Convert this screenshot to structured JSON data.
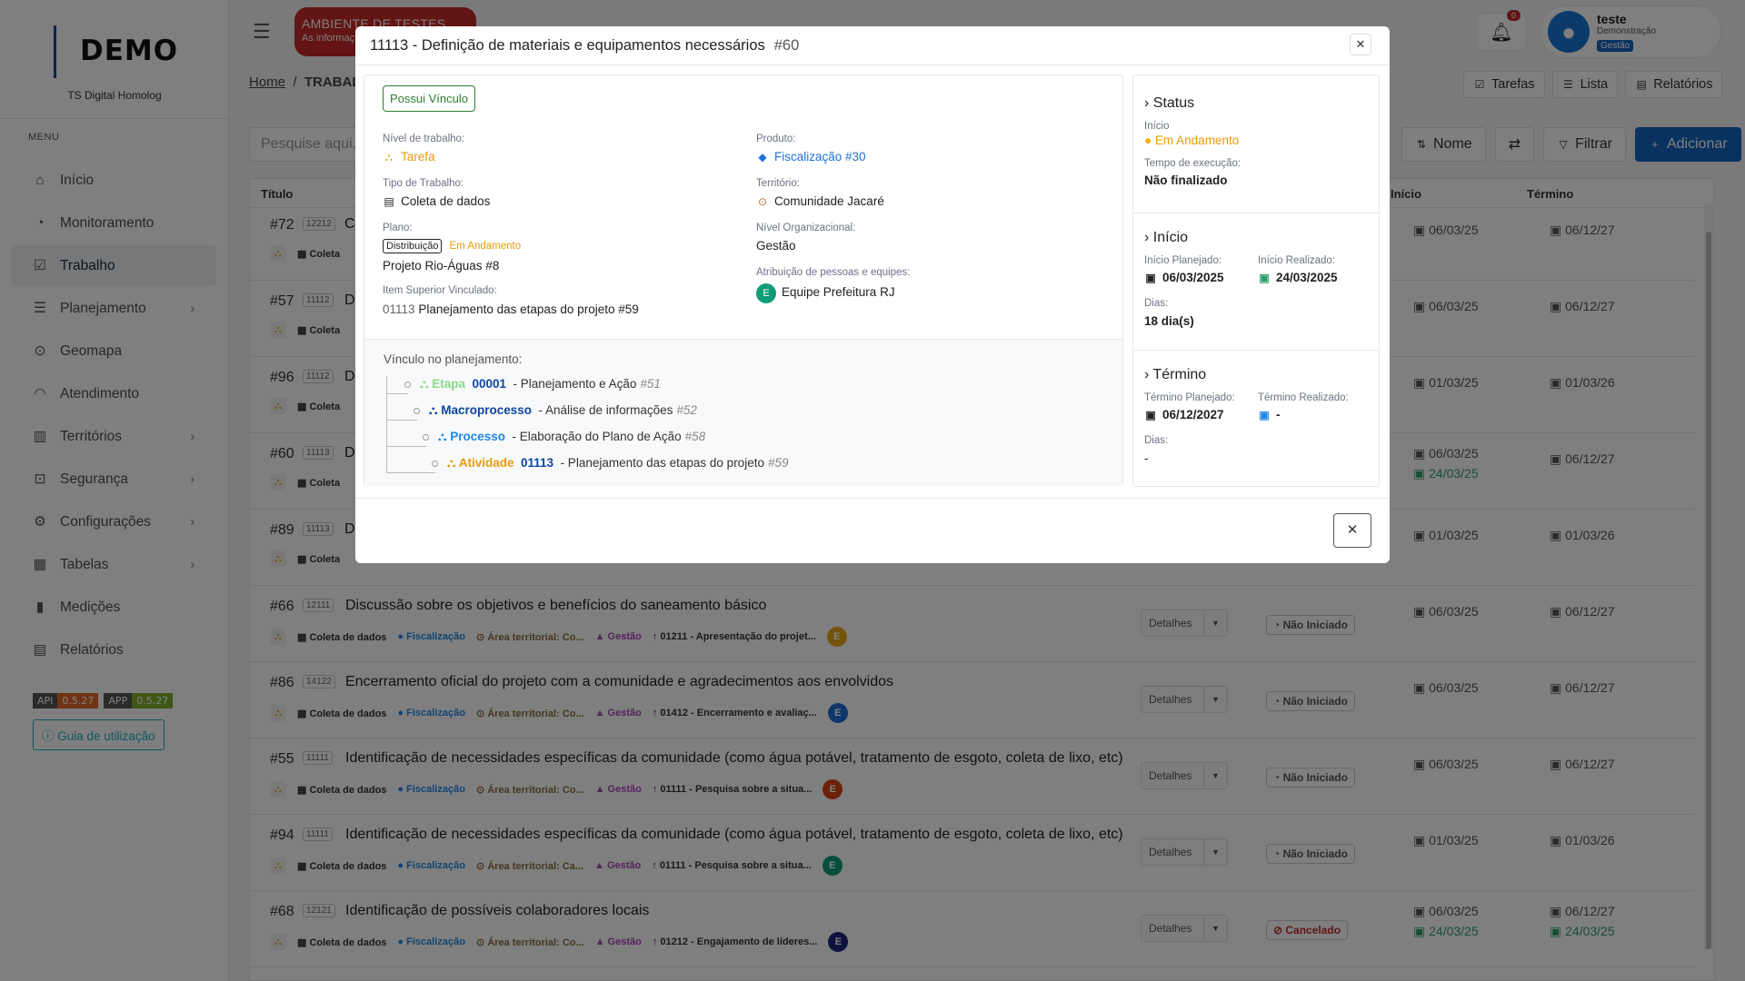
{
  "sidebar": {
    "logo": "DEMO",
    "subtitle": "TS Digital Homolog",
    "menu_title": "MENU",
    "items": [
      {
        "label": "Início",
        "icon": "home-icon"
      },
      {
        "label": "Monitoramento",
        "icon": "gauge-icon"
      },
      {
        "label": "Trabalho",
        "icon": "checkbox-icon"
      },
      {
        "label": "Planejamento",
        "icon": "list-icon"
      },
      {
        "label": "Geomapa",
        "icon": "map-pin-icon"
      },
      {
        "label": "Atendimento",
        "icon": "headset-icon"
      },
      {
        "label": "Territórios",
        "icon": "map-icon"
      },
      {
        "label": "Segurança",
        "icon": "lock-icon"
      },
      {
        "label": "Configurações",
        "icon": "gear-icon"
      },
      {
        "label": "Tabelas",
        "icon": "table-icon"
      },
      {
        "label": "Medições",
        "icon": "bar-chart-icon"
      },
      {
        "label": "Relatórios",
        "icon": "report-icon"
      }
    ],
    "api_label": "API",
    "api_version": "0.5.27",
    "app_label": "APP",
    "app_version": "0.5.27",
    "guide": "Guia de utilização"
  },
  "header": {
    "env_title": "AMBIENTE DE TESTES",
    "env_sub": "As informaç",
    "notif_count": "0",
    "user_name": "teste",
    "user_org": "Demonstração",
    "user_badge": "Gestão"
  },
  "breadcrumb": {
    "home": "Home",
    "current": "TRABALI"
  },
  "views": {
    "tasks": "Tarefas",
    "list": "Lista",
    "reports": "Relatórios"
  },
  "toolbar": {
    "search_placeholder": "Pesquise aqui...",
    "sort": "Nome",
    "filter": "Filtrar",
    "add": "Adicionar"
  },
  "table": {
    "col_title": "Título",
    "col_start": "Início",
    "col_end": "Término",
    "details_label": "Detalhes",
    "rows": [
      {
        "num": "#72",
        "code": "12212",
        "title": "C",
        "type": "Coleta",
        "d1": "06/03/25",
        "d1b": "",
        "d2": "06/12/27"
      },
      {
        "num": "#57",
        "code": "11112",
        "title": "D",
        "type": "Coleta",
        "d1": "06/03/25",
        "d1b": "",
        "d2": "06/12/27"
      },
      {
        "num": "#96",
        "code": "11112",
        "title": "D",
        "type": "Coleta",
        "d1": "01/03/25",
        "d1b": "",
        "d2": "01/03/26"
      },
      {
        "num": "#60",
        "code": "11113",
        "title": "D",
        "type": "Coleta",
        "d1": "06/03/25",
        "d1b": "24/03/25",
        "d2": "06/12/27"
      },
      {
        "num": "#89",
        "code": "11113",
        "title": "D",
        "type": "Coleta",
        "d1": "01/03/25",
        "d1b": "",
        "d2": "01/03/26"
      },
      {
        "num": "#66",
        "code": "12111",
        "title": "Discussão sobre os objetivos e benefícios do saneamento básico",
        "type": "Coleta de dados",
        "prod": "Fiscalização",
        "terr": "Área territorial: Co...",
        "org": "Gestão",
        "parent": "01211 - Apresentação do projet...",
        "avatar": "E",
        "avatar_color": "#e6a817",
        "status": "Não Iniciado",
        "d1": "06/03/25",
        "d1b": "",
        "d2": "06/12/27"
      },
      {
        "num": "#86",
        "code": "14122",
        "title": "Encerramento oficial do projeto com a comunidade e agradecimentos aos envolvidos",
        "type": "Coleta de dados",
        "prod": "Fiscalização",
        "terr": "Área territorial: Co...",
        "org": "Gestão",
        "parent": "01412 - Encerramento e avaliaç...",
        "avatar": "E",
        "avatar_color": "#1e6fd9",
        "status": "Não Iniciado",
        "d1": "06/03/25",
        "d1b": "",
        "d2": "06/12/27"
      },
      {
        "num": "#55",
        "code": "11111",
        "title": "Identificação de necessidades específicas da comunidade (como água potável, tratamento de esgoto, coleta de lixo, etc)",
        "type": "Coleta de dados",
        "prod": "Fiscalização",
        "terr": "Área territorial: Co...",
        "org": "Gestão",
        "parent": "01111 - Pesquisa sobre a situa...",
        "avatar": "E",
        "avatar_color": "#d84315",
        "status": "Não Iniciado",
        "d1": "06/03/25",
        "d1b": "",
        "d2": "06/12/27"
      },
      {
        "num": "#94",
        "code": "11111",
        "title": "Identificação de necessidades específicas da comunidade (como água potável, tratamento de esgoto, coleta de lixo, etc)",
        "type": "Coleta de dados",
        "prod": "Fiscalização",
        "terr": "Área territorial: Ca...",
        "org": "Gestão",
        "parent": "01111 - Pesquisa sobre a situa...",
        "avatar": "E",
        "avatar_color": "#0f9d76",
        "status": "Não Iniciado",
        "d1": "01/03/25",
        "d1b": "",
        "d2": "01/03/26"
      },
      {
        "num": "#68",
        "code": "12121",
        "title": "Identificação de possíveis colaboradores locais",
        "type": "Coleta de dados",
        "prod": "Fiscalização",
        "terr": "Área territorial: Co...",
        "org": "Gestão",
        "parent": "01212 - Engajamento de líderes...",
        "avatar": "E",
        "avatar_color": "#1a237e",
        "status": "Cancelado",
        "d1": "06/03/25",
        "d1b": "24/03/25",
        "d2": "06/12/27",
        "d2b": "24/03/25"
      }
    ]
  },
  "modal": {
    "title": "11113 - Definição de materiais e equipamentos necessários",
    "id": "#60",
    "vinculo": "Possui Vínculo",
    "nivel_label": "Nível de trabalho:",
    "nivel_value": "Tarefa",
    "produto_label": "Produto:",
    "produto_value": "Fiscalização #30",
    "tipo_label": "Tipo de Trabalho:",
    "tipo_value": "Coleta de dados",
    "territorio_label": "Território:",
    "territorio_value": "Comunidade Jacaré",
    "plano_label": "Plano:",
    "plano_tag": "Distribuição",
    "plano_status": "Em Andamento",
    "plano_value": "Projeto Rio-Águas #8",
    "nivel_org_label": "Nível Organizacional:",
    "nivel_org_value": "Gestão",
    "item_sup_label": "Item Superior Vinculado:",
    "item_sup_code": "01113",
    "item_sup_value": "Planejamento das etapas do projeto #59",
    "atrib_label": "Atribuição de pessoas e equipes:",
    "atrib_value": "Equipe Prefeitura RJ",
    "atrib_avatar": "E",
    "plan_label": "Vínculo no planejamento:",
    "tree": [
      {
        "kind": "Etapa",
        "code": "00001",
        "text": "- Planejamento e Ação",
        "ref": "#51",
        "color": "#8bd98b"
      },
      {
        "kind": "Macroprocesso",
        "code": "",
        "text": "- Análise de informações",
        "ref": "#52",
        "color": "#0d47a1"
      },
      {
        "kind": "Processo",
        "code": "",
        "text": "- Elaboração do Plano de Ação",
        "ref": "#58",
        "color": "#1e88e5"
      },
      {
        "kind": "Atividade",
        "code": "01113",
        "text": "- Planejamento das etapas do projeto",
        "ref": "#59",
        "color": "#e89a0c"
      }
    ],
    "status": {
      "title": "Status",
      "inicio_label": "Início",
      "inicio_value": "Em Andamento",
      "tempo_label": "Tempo de execução:",
      "tempo_value": "Não finalizado"
    },
    "inicio": {
      "title": "Início",
      "planejado_label": "Início Planejado:",
      "planejado_value": "06/03/2025",
      "realizado_label": "Início Realizado:",
      "realizado_value": "24/03/2025",
      "dias_label": "Dias:",
      "dias_value": "18 dia(s)"
    },
    "termino": {
      "title": "Término",
      "planejado_label": "Término Planejado:",
      "planejado_value": "06/12/2027",
      "realizado_label": "Término Realizado:",
      "realizado_value": "-",
      "dias_label": "Dias:",
      "dias_value": "-"
    }
  }
}
